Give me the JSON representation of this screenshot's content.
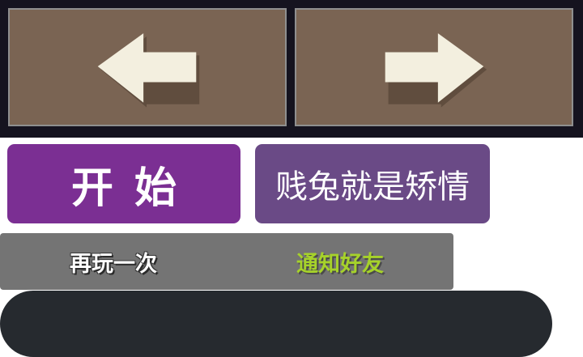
{
  "arrows": {
    "left_icon": "arrow-left-icon",
    "right_icon": "arrow-right-icon",
    "arrow_color": "#f3efdf",
    "arrow_shadow": "#4b3b2e"
  },
  "buttons": {
    "start_label": "开始",
    "slogan_label": "贱兔就是矫情",
    "replay_label": "再玩一次",
    "notify_label": "通知好友"
  },
  "colors": {
    "panel_bg": "#15131f",
    "arrow_button": "#7a6453",
    "start_button": "#7b2f93",
    "slogan_button": "#6a4a86",
    "gray_button": "#747474",
    "notify_text": "#a6d22a",
    "dark_bar": "#262a2f"
  }
}
